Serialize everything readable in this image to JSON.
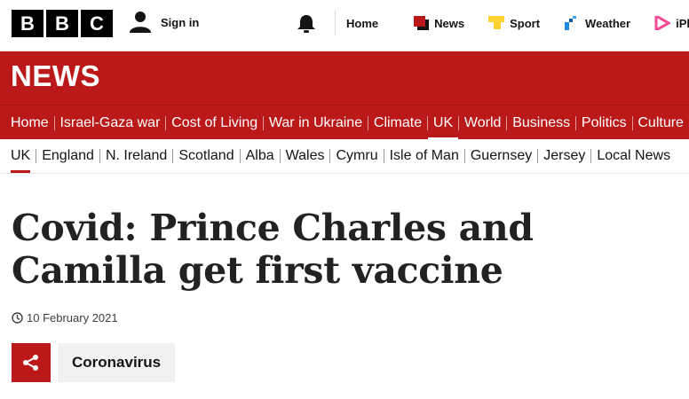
{
  "brand": {
    "letters": [
      "B",
      "B",
      "C"
    ]
  },
  "account": {
    "signin_label": "Sign in"
  },
  "topnav": [
    {
      "label": "Home",
      "icon": ""
    },
    {
      "label": "News",
      "icon": "news-icon",
      "color": "#bb1919"
    },
    {
      "label": "Sport",
      "icon": "sport-icon",
      "color": "#ffd230"
    },
    {
      "label": "Weather",
      "icon": "weather-icon",
      "color": "#1e88e5"
    },
    {
      "label": "iPlayer",
      "icon": "iplayer-icon",
      "color": "#f54997"
    }
  ],
  "news_banner": {
    "title": "NEWS"
  },
  "section_nav": {
    "items": [
      "Home",
      "Israel-Gaza war",
      "Cost of Living",
      "War in Ukraine",
      "Climate",
      "UK",
      "World",
      "Business",
      "Politics",
      "Culture"
    ],
    "active": "UK"
  },
  "sub_nav": {
    "items": [
      "UK",
      "England",
      "N. Ireland",
      "Scotland",
      "Alba",
      "Wales",
      "Cymru",
      "Isle of Man",
      "Guernsey",
      "Jersey",
      "Local News"
    ],
    "active": "UK"
  },
  "article": {
    "headline": "Covid: Prince Charles and Camilla get first vaccine",
    "date": "10 February 2021",
    "topic": "Coronavirus"
  },
  "colors": {
    "brand_red": "#bb1919",
    "topbar_bg": "#ffffff",
    "tag_bg": "#f1f1f1"
  }
}
